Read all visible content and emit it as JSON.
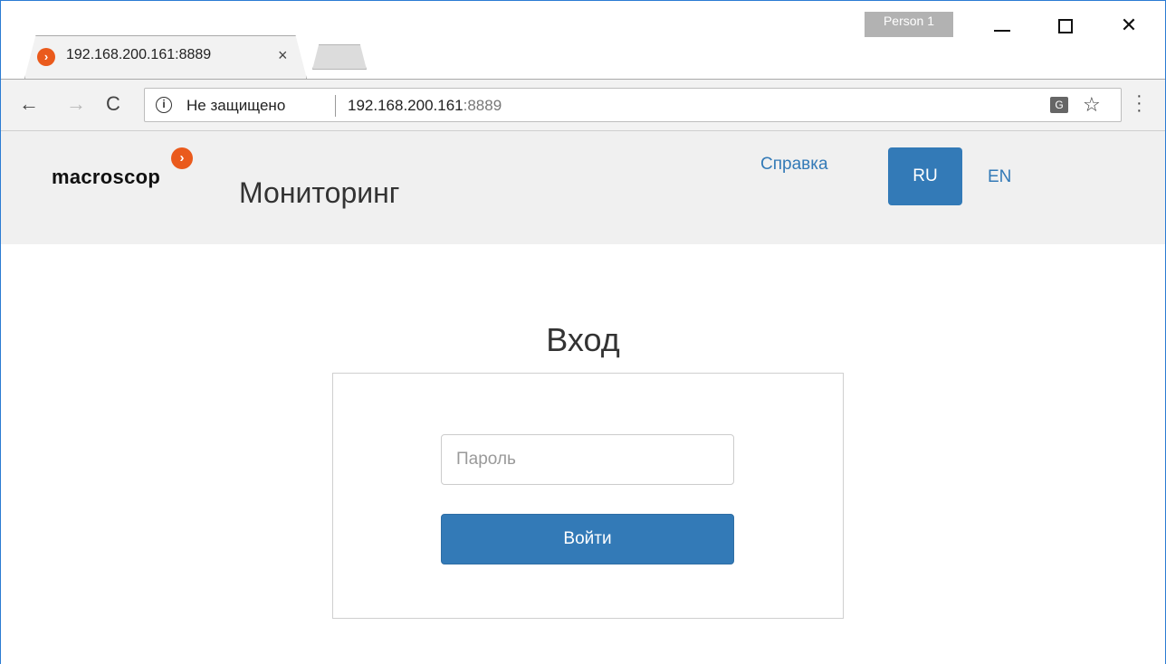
{
  "browser": {
    "tab": {
      "title": "192.168.200.161:8889",
      "close": "×"
    },
    "profile_label": "Person 1",
    "window_controls": {
      "close": "✕"
    },
    "nav": {
      "back": "←",
      "forward": "→",
      "reload": "C"
    },
    "omnibox": {
      "security_text": "Не защищено",
      "host": "192.168.200.161",
      "port": ":8889",
      "translate_icon": "translate-icon",
      "star_icon": "bookmark-star-icon"
    }
  },
  "site": {
    "logo_text": "macroscop",
    "title": "Мониторинг",
    "help_link": "Справка",
    "languages": {
      "ru": "RU",
      "en": "EN"
    }
  },
  "login": {
    "heading": "Вход",
    "password_placeholder": "Пароль",
    "submit_label": "Войти"
  },
  "colors": {
    "accent": "#337ab7",
    "brand_orange": "#ea5a1c",
    "header_bg": "#f0f0f0"
  }
}
